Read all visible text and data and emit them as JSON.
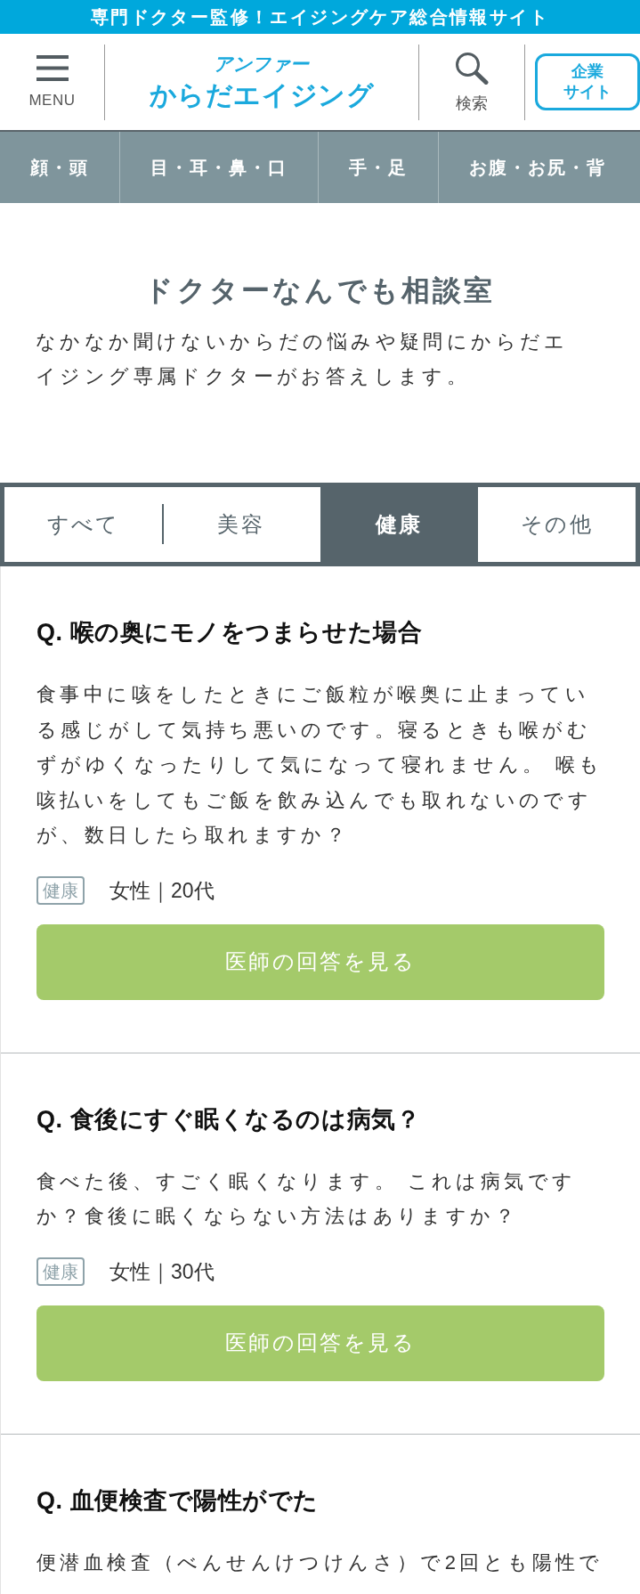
{
  "top_banner": {
    "text": "専門ドクター監修！エイジングケア総合情報サイト"
  },
  "header": {
    "menu_label": "MENU",
    "logo": {
      "brand": "アンファー",
      "name": "からだエイジング"
    },
    "search_label": "検索",
    "corporate_button": [
      "企業",
      "サイト"
    ]
  },
  "category_nav": [
    "顔・頭",
    "目・耳・鼻・口",
    "手・足",
    "お腹・お尻・背"
  ],
  "page_title": "ドクターなんでも相談室",
  "intro": "なかなか聞けないからだの悩みや疑問にからだエイジング専属ドクターがお答えします。",
  "filter_tabs": [
    {
      "label": "すべて",
      "selected": false
    },
    {
      "label": "美容",
      "selected": false
    },
    {
      "label": "健康",
      "selected": true
    },
    {
      "label": "その他",
      "selected": false
    }
  ],
  "questions": [
    {
      "title": "Q. 喉の奥にモノをつまらせた場合",
      "body": "食事中に咳をしたときにご飯粒が喉奥に止まっている感じがして気持ち悪いのです。寝るときも喉がむずがゆくなったりして気になって寝れません。 喉も咳払いをしてもご飯を飲み込んでも取れないのですが、数日したら取れますか？",
      "tag": "健康",
      "meta": "女性｜20代",
      "button": "医師の回答を見る"
    },
    {
      "title": "Q. 食後にすぐ眠くなるのは病気？",
      "body": "食べた後、すごく眠くなります。 これは病気ですか？食後に眠くならない方法はありますか？",
      "tag": "健康",
      "meta": "女性｜30代",
      "button": "医師の回答を見る"
    },
    {
      "title": "Q. 血便検査で陽性がでた",
      "body": "便潜血検査（べんせんけつけんさ）で2回とも陽性で"
    }
  ]
}
